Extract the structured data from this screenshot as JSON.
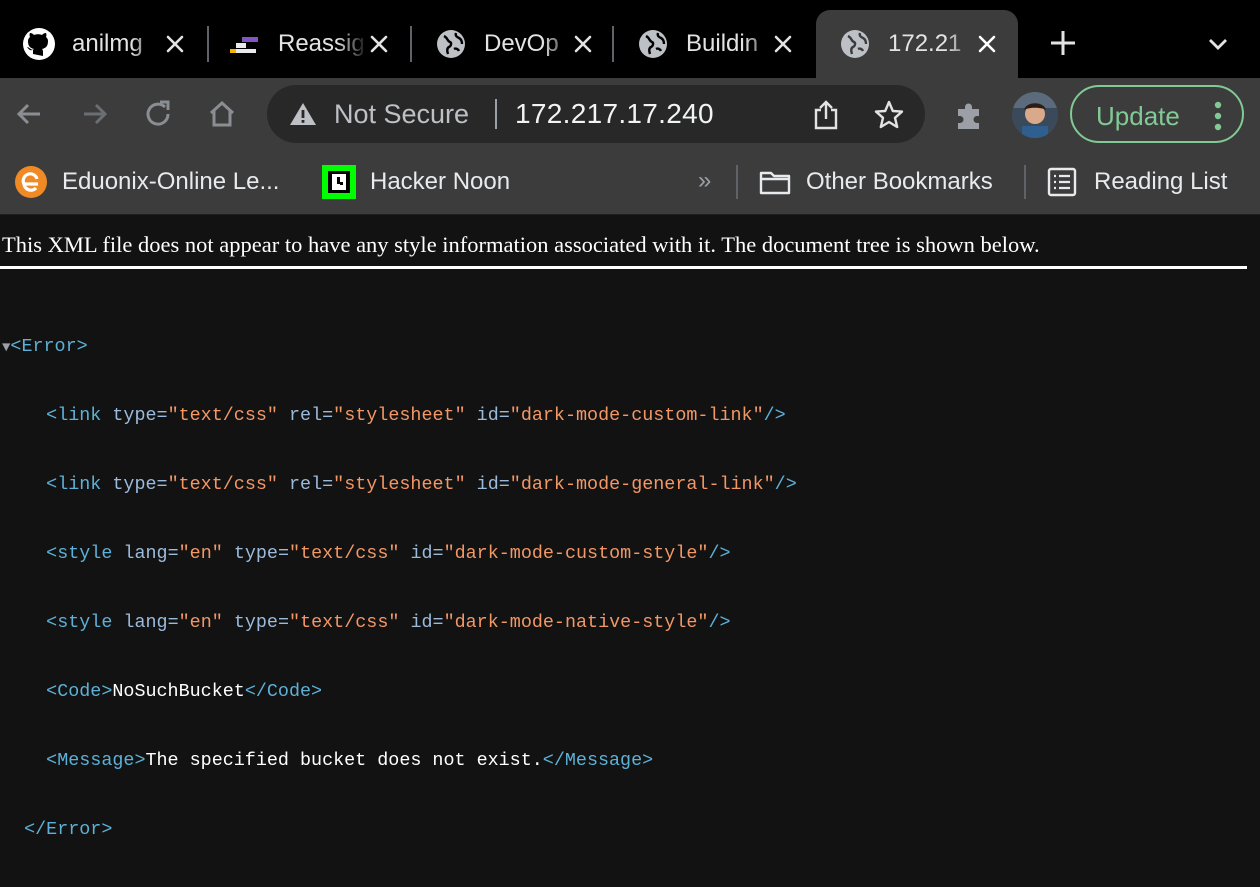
{
  "tabs": [
    {
      "title": "anilmg",
      "icon": "github-icon"
    },
    {
      "title": "Reassig",
      "icon": "bars-icon"
    },
    {
      "title": "DevOp",
      "icon": "globe-icon"
    },
    {
      "title": "Buildin",
      "icon": "globe-icon"
    },
    {
      "title": "172.21",
      "icon": "globe-icon",
      "active": true
    }
  ],
  "toolbar": {
    "security_label": "Not Secure",
    "url": "172.217.17.240",
    "update_label": "Update"
  },
  "bookmarks": {
    "items": [
      {
        "label": "Eduonix-Online Le...",
        "icon": "eduonix-icon"
      },
      {
        "label": "Hacker Noon",
        "icon": "hackernoon-icon"
      }
    ],
    "overflow": "»",
    "other_label": "Other Bookmarks",
    "reading_list_label": "Reading List"
  },
  "content": {
    "info": "This XML file does not appear to have any style information associated with it. The document tree is shown below.",
    "root_tag": "Error",
    "links": [
      {
        "type": "text/css",
        "rel": "stylesheet",
        "id": "dark-mode-custom-link"
      },
      {
        "type": "text/css",
        "rel": "stylesheet",
        "id": "dark-mode-general-link"
      }
    ],
    "styles": [
      {
        "lang": "en",
        "type": "text/css",
        "id": "dark-mode-custom-style"
      },
      {
        "lang": "en",
        "type": "text/css",
        "id": "dark-mode-native-style"
      }
    ],
    "code": "NoSuchBucket",
    "message": "The specified bucket does not exist."
  },
  "colors": {
    "accent_update": "#81c995",
    "xml_tag": "#5db0d7",
    "xml_attr_value": "#f29766"
  }
}
